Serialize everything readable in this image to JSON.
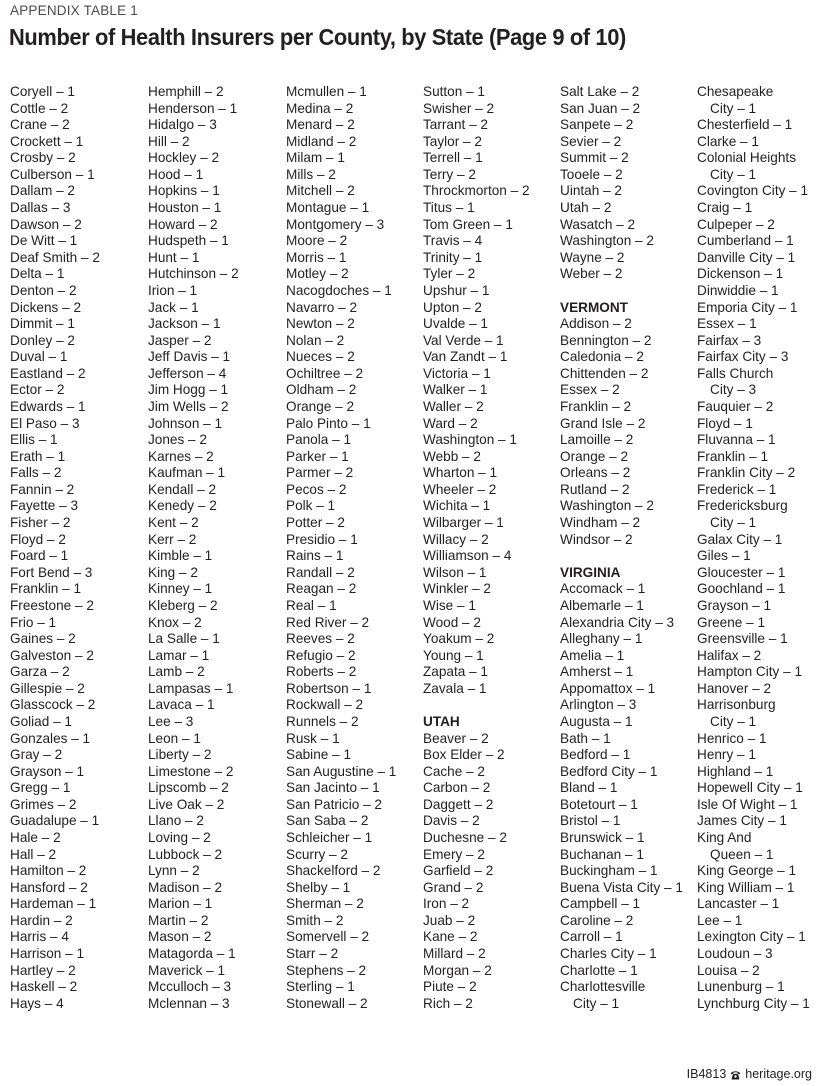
{
  "header": {
    "eyebrow": "APPENDIX TABLE 1",
    "title": "Number of Health Insurers per County, by State (Page 9 of 10)"
  },
  "columns": [
    {
      "lines": [
        {
          "text": "Coryell – 1"
        },
        {
          "text": "Cottle – 2"
        },
        {
          "text": "Crane – 2"
        },
        {
          "text": "Crockett – 1"
        },
        {
          "text": "Crosby – 2"
        },
        {
          "text": "Culberson – 1"
        },
        {
          "text": "Dallam – 2"
        },
        {
          "text": "Dallas – 3"
        },
        {
          "text": "Dawson – 2"
        },
        {
          "text": "De Witt – 1"
        },
        {
          "text": "Deaf Smith – 2"
        },
        {
          "text": "Delta – 1"
        },
        {
          "text": "Denton – 2"
        },
        {
          "text": "Dickens – 2"
        },
        {
          "text": "Dimmit – 1"
        },
        {
          "text": "Donley – 2"
        },
        {
          "text": "Duval – 1"
        },
        {
          "text": "Eastland – 2"
        },
        {
          "text": "Ector – 2"
        },
        {
          "text": "Edwards – 1"
        },
        {
          "text": "El Paso – 3"
        },
        {
          "text": "Ellis – 1"
        },
        {
          "text": "Erath – 1"
        },
        {
          "text": "Falls – 2"
        },
        {
          "text": "Fannin – 2"
        },
        {
          "text": "Fayette – 3"
        },
        {
          "text": "Fisher – 2"
        },
        {
          "text": "Floyd – 2"
        },
        {
          "text": "Foard – 1"
        },
        {
          "text": "Fort Bend – 3"
        },
        {
          "text": "Franklin – 1"
        },
        {
          "text": "Freestone – 2"
        },
        {
          "text": "Frio – 1"
        },
        {
          "text": "Gaines – 2"
        },
        {
          "text": "Galveston – 2"
        },
        {
          "text": "Garza – 2"
        },
        {
          "text": "Gillespie – 2"
        },
        {
          "text": "Glasscock – 2"
        },
        {
          "text": "Goliad – 1"
        },
        {
          "text": "Gonzales – 1"
        },
        {
          "text": "Gray – 2"
        },
        {
          "text": "Grayson – 1"
        },
        {
          "text": "Gregg – 1"
        },
        {
          "text": "Grimes – 2"
        },
        {
          "text": "Guadalupe – 1"
        },
        {
          "text": "Hale – 2"
        },
        {
          "text": "Hall – 2"
        },
        {
          "text": "Hamilton – 2"
        },
        {
          "text": "Hansford – 2"
        },
        {
          "text": "Hardeman – 1"
        },
        {
          "text": "Hardin – 2"
        },
        {
          "text": "Harris – 4"
        },
        {
          "text": "Harrison – 1"
        },
        {
          "text": "Hartley – 2"
        },
        {
          "text": "Haskell – 2"
        },
        {
          "text": "Hays – 4"
        }
      ]
    },
    {
      "lines": [
        {
          "text": "Hemphill – 2"
        },
        {
          "text": "Henderson – 1"
        },
        {
          "text": "Hidalgo – 3"
        },
        {
          "text": "Hill – 2"
        },
        {
          "text": "Hockley – 2"
        },
        {
          "text": "Hood – 1"
        },
        {
          "text": "Hopkins – 1"
        },
        {
          "text": "Houston – 1"
        },
        {
          "text": "Howard – 2"
        },
        {
          "text": "Hudspeth – 1"
        },
        {
          "text": "Hunt – 1"
        },
        {
          "text": "Hutchinson – 2"
        },
        {
          "text": "Irion – 1"
        },
        {
          "text": "Jack – 1"
        },
        {
          "text": "Jackson – 1"
        },
        {
          "text": "Jasper – 2"
        },
        {
          "text": "Jeff Davis – 1"
        },
        {
          "text": "Jefferson – 4"
        },
        {
          "text": "Jim Hogg – 1"
        },
        {
          "text": "Jim Wells – 2"
        },
        {
          "text": "Johnson – 1"
        },
        {
          "text": "Jones – 2"
        },
        {
          "text": "Karnes – 2"
        },
        {
          "text": "Kaufman – 1"
        },
        {
          "text": "Kendall – 2"
        },
        {
          "text": "Kenedy – 2"
        },
        {
          "text": "Kent – 2"
        },
        {
          "text": "Kerr – 2"
        },
        {
          "text": "Kimble – 1"
        },
        {
          "text": "King – 2"
        },
        {
          "text": "Kinney – 1"
        },
        {
          "text": "Kleberg – 2"
        },
        {
          "text": "Knox – 2"
        },
        {
          "text": "La Salle – 1"
        },
        {
          "text": "Lamar – 1"
        },
        {
          "text": "Lamb – 2"
        },
        {
          "text": "Lampasas – 1"
        },
        {
          "text": "Lavaca – 1"
        },
        {
          "text": "Lee – 3"
        },
        {
          "text": "Leon – 1"
        },
        {
          "text": "Liberty – 2"
        },
        {
          "text": "Limestone – 2"
        },
        {
          "text": "Lipscomb – 2"
        },
        {
          "text": "Live Oak – 2"
        },
        {
          "text": "Llano – 2"
        },
        {
          "text": "Loving – 2"
        },
        {
          "text": "Lubbock – 2"
        },
        {
          "text": "Lynn – 2"
        },
        {
          "text": "Madison – 2"
        },
        {
          "text": "Marion – 1"
        },
        {
          "text": "Martin – 2"
        },
        {
          "text": "Mason – 2"
        },
        {
          "text": "Matagorda – 1"
        },
        {
          "text": "Maverick – 1"
        },
        {
          "text": "Mcculloch – 3"
        },
        {
          "text": "Mclennan – 3"
        }
      ]
    },
    {
      "lines": [
        {
          "text": "Mcmullen – 1"
        },
        {
          "text": "Medina – 2"
        },
        {
          "text": "Menard – 2"
        },
        {
          "text": "Midland – 2"
        },
        {
          "text": "Milam – 1"
        },
        {
          "text": "Mills – 2"
        },
        {
          "text": "Mitchell – 2"
        },
        {
          "text": "Montague – 1"
        },
        {
          "text": "Montgomery – 3"
        },
        {
          "text": "Moore – 2"
        },
        {
          "text": "Morris – 1"
        },
        {
          "text": "Motley – 2"
        },
        {
          "text": "Nacogdoches – 1"
        },
        {
          "text": "Navarro – 2"
        },
        {
          "text": "Newton – 2"
        },
        {
          "text": "Nolan – 2"
        },
        {
          "text": "Nueces – 2"
        },
        {
          "text": "Ochiltree – 2"
        },
        {
          "text": "Oldham – 2"
        },
        {
          "text": "Orange – 2"
        },
        {
          "text": "Palo Pinto – 1"
        },
        {
          "text": "Panola – 1"
        },
        {
          "text": "Parker – 1"
        },
        {
          "text": "Parmer – 2"
        },
        {
          "text": "Pecos – 2"
        },
        {
          "text": "Polk – 1"
        },
        {
          "text": "Potter – 2"
        },
        {
          "text": "Presidio – 1"
        },
        {
          "text": "Rains – 1"
        },
        {
          "text": "Randall – 2"
        },
        {
          "text": "Reagan – 2"
        },
        {
          "text": "Real – 1"
        },
        {
          "text": "Red River – 2"
        },
        {
          "text": "Reeves – 2"
        },
        {
          "text": "Refugio – 2"
        },
        {
          "text": "Roberts – 2"
        },
        {
          "text": "Robertson – 1"
        },
        {
          "text": "Rockwall – 2"
        },
        {
          "text": "Runnels – 2"
        },
        {
          "text": "Rusk – 1"
        },
        {
          "text": "Sabine – 1"
        },
        {
          "text": "San Augustine – 1"
        },
        {
          "text": "San Jacinto – 1"
        },
        {
          "text": "San Patricio – 2"
        },
        {
          "text": "San Saba – 2"
        },
        {
          "text": "Schleicher – 1"
        },
        {
          "text": "Scurry – 2"
        },
        {
          "text": "Shackelford – 2"
        },
        {
          "text": "Shelby – 1"
        },
        {
          "text": "Sherman – 2"
        },
        {
          "text": "Smith – 2"
        },
        {
          "text": "Somervell – 2"
        },
        {
          "text": "Starr – 2"
        },
        {
          "text": "Stephens – 2"
        },
        {
          "text": "Sterling – 1"
        },
        {
          "text": "Stonewall – 2"
        }
      ]
    },
    {
      "lines": [
        {
          "text": "Sutton – 1"
        },
        {
          "text": "Swisher – 2"
        },
        {
          "text": "Tarrant – 2"
        },
        {
          "text": "Taylor – 2"
        },
        {
          "text": "Terrell – 1"
        },
        {
          "text": "Terry – 2"
        },
        {
          "text": "Throckmorton – 2"
        },
        {
          "text": "Titus – 1"
        },
        {
          "text": "Tom Green – 1"
        },
        {
          "text": "Travis – 4"
        },
        {
          "text": "Trinity – 1"
        },
        {
          "text": "Tyler – 2"
        },
        {
          "text": "Upshur – 1"
        },
        {
          "text": "Upton – 2"
        },
        {
          "text": "Uvalde – 1"
        },
        {
          "text": "Val Verde – 1"
        },
        {
          "text": "Van Zandt – 1"
        },
        {
          "text": "Victoria – 1"
        },
        {
          "text": "Walker – 1"
        },
        {
          "text": "Waller – 2"
        },
        {
          "text": "Ward – 2"
        },
        {
          "text": "Washington – 1"
        },
        {
          "text": "Webb – 2"
        },
        {
          "text": "Wharton – 1"
        },
        {
          "text": "Wheeler – 2"
        },
        {
          "text": "Wichita – 1"
        },
        {
          "text": "Wilbarger – 1"
        },
        {
          "text": "Willacy – 2"
        },
        {
          "text": "Williamson – 4"
        },
        {
          "text": "Wilson – 1"
        },
        {
          "text": "Winkler – 2"
        },
        {
          "text": "Wise – 1"
        },
        {
          "text": "Wood – 2"
        },
        {
          "text": "Yoakum – 2"
        },
        {
          "text": "Young – 1"
        },
        {
          "text": "Zapata – 1"
        },
        {
          "text": "Zavala – 1"
        },
        {
          "text": "",
          "kind": "blank"
        },
        {
          "text": "UTAH",
          "kind": "state"
        },
        {
          "text": "Beaver – 2"
        },
        {
          "text": "Box Elder – 2"
        },
        {
          "text": "Cache – 2"
        },
        {
          "text": "Carbon – 2"
        },
        {
          "text": "Daggett – 2"
        },
        {
          "text": "Davis – 2"
        },
        {
          "text": "Duchesne – 2"
        },
        {
          "text": "Emery – 2"
        },
        {
          "text": "Garfield – 2"
        },
        {
          "text": "Grand – 2"
        },
        {
          "text": "Iron – 2"
        },
        {
          "text": "Juab – 2"
        },
        {
          "text": "Kane – 2"
        },
        {
          "text": "Millard – 2"
        },
        {
          "text": "Morgan – 2"
        },
        {
          "text": "Piute – 2"
        },
        {
          "text": "Rich – 2"
        }
      ]
    },
    {
      "lines": [
        {
          "text": "Salt Lake – 2"
        },
        {
          "text": "San Juan – 2"
        },
        {
          "text": "Sanpete – 2"
        },
        {
          "text": "Sevier – 2"
        },
        {
          "text": "Summit – 2"
        },
        {
          "text": "Tooele – 2"
        },
        {
          "text": "Uintah – 2"
        },
        {
          "text": "Utah – 2"
        },
        {
          "text": "Wasatch – 2"
        },
        {
          "text": "Washington – 2"
        },
        {
          "text": "Wayne – 2"
        },
        {
          "text": "Weber – 2"
        },
        {
          "text": "",
          "kind": "blank"
        },
        {
          "text": "VERMONT",
          "kind": "state"
        },
        {
          "text": "Addison – 2"
        },
        {
          "text": "Bennington – 2"
        },
        {
          "text": "Caledonia – 2"
        },
        {
          "text": "Chittenden – 2"
        },
        {
          "text": "Essex – 2"
        },
        {
          "text": "Franklin – 2"
        },
        {
          "text": "Grand Isle – 2"
        },
        {
          "text": "Lamoille – 2"
        },
        {
          "text": "Orange – 2"
        },
        {
          "text": "Orleans – 2"
        },
        {
          "text": "Rutland – 2"
        },
        {
          "text": "Washington – 2"
        },
        {
          "text": "Windham – 2"
        },
        {
          "text": "Windsor – 2"
        },
        {
          "text": "",
          "kind": "blank"
        },
        {
          "text": "VIRGINIA",
          "kind": "state"
        },
        {
          "text": "Accomack – 1"
        },
        {
          "text": "Albemarle – 1"
        },
        {
          "text": "Alexandria City – 3"
        },
        {
          "text": "Alleghany – 1"
        },
        {
          "text": "Amelia – 1"
        },
        {
          "text": "Amherst – 1"
        },
        {
          "text": "Appomattox – 1"
        },
        {
          "text": "Arlington – 3"
        },
        {
          "text": "Augusta – 1"
        },
        {
          "text": "Bath – 1"
        },
        {
          "text": "Bedford – 1"
        },
        {
          "text": "Bedford City – 1"
        },
        {
          "text": "Bland – 1"
        },
        {
          "text": "Botetourt – 1"
        },
        {
          "text": "Bristol – 1"
        },
        {
          "text": "Brunswick – 1"
        },
        {
          "text": "Buchanan – 1"
        },
        {
          "text": "Buckingham – 1"
        },
        {
          "text": "Buena Vista City – 1"
        },
        {
          "text": "Campbell – 1"
        },
        {
          "text": "Caroline – 2"
        },
        {
          "text": "Carroll – 1"
        },
        {
          "text": "Charles City – 1"
        },
        {
          "text": "Charlotte – 1"
        },
        {
          "text": "Charlottesville"
        },
        {
          "text": "City – 1",
          "kind": "cont"
        }
      ]
    },
    {
      "lines": [
        {
          "text": "Chesapeake"
        },
        {
          "text": "City – 1",
          "kind": "cont"
        },
        {
          "text": "Chesterfield – 1"
        },
        {
          "text": "Clarke – 1"
        },
        {
          "text": "Colonial Heights"
        },
        {
          "text": "City – 1",
          "kind": "cont"
        },
        {
          "text": "Covington City – 1"
        },
        {
          "text": "Craig – 1"
        },
        {
          "text": "Culpeper – 2"
        },
        {
          "text": "Cumberland – 1"
        },
        {
          "text": "Danville City – 1"
        },
        {
          "text": "Dickenson – 1"
        },
        {
          "text": "Dinwiddie – 1"
        },
        {
          "text": "Emporia City – 1"
        },
        {
          "text": "Essex – 1"
        },
        {
          "text": "Fairfax – 3"
        },
        {
          "text": "Fairfax City – 3"
        },
        {
          "text": "Falls Church"
        },
        {
          "text": "City – 3",
          "kind": "cont"
        },
        {
          "text": "Fauquier – 2"
        },
        {
          "text": "Floyd – 1"
        },
        {
          "text": "Fluvanna – 1"
        },
        {
          "text": "Franklin – 1"
        },
        {
          "text": "Franklin City – 2"
        },
        {
          "text": "Frederick – 1"
        },
        {
          "text": "Fredericksburg"
        },
        {
          "text": "City – 1",
          "kind": "cont"
        },
        {
          "text": "Galax City – 1"
        },
        {
          "text": "Giles – 1"
        },
        {
          "text": "Gloucester – 1"
        },
        {
          "text": "Goochland – 1"
        },
        {
          "text": "Grayson – 1"
        },
        {
          "text": "Greene – 1"
        },
        {
          "text": "Greensville – 1"
        },
        {
          "text": "Halifax – 2"
        },
        {
          "text": "Hampton City – 1"
        },
        {
          "text": "Hanover – 2"
        },
        {
          "text": "Harrisonburg"
        },
        {
          "text": "City – 1",
          "kind": "cont"
        },
        {
          "text": "Henrico – 1"
        },
        {
          "text": "Henry – 1"
        },
        {
          "text": "Highland – 1"
        },
        {
          "text": "Hopewell City – 1"
        },
        {
          "text": "Isle Of Wight – 1"
        },
        {
          "text": "James City – 1"
        },
        {
          "text": "King And"
        },
        {
          "text": "Queen – 1",
          "kind": "cont"
        },
        {
          "text": "King George – 1"
        },
        {
          "text": "King William – 1"
        },
        {
          "text": "Lancaster – 1"
        },
        {
          "text": "Lee – 1"
        },
        {
          "text": "Lexington City – 1"
        },
        {
          "text": "Loudoun – 3"
        },
        {
          "text": "Louisa – 2"
        },
        {
          "text": "Lunenburg – 1"
        },
        {
          "text": "Lynchburg City – 1"
        }
      ]
    }
  ],
  "footer": {
    "report_id": "IB4813",
    "icon": "phone-icon",
    "site": "heritage.org"
  }
}
